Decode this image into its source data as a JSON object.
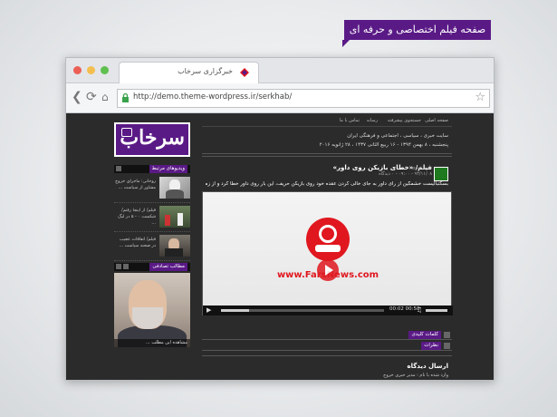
{
  "promo": {
    "label": "صفحه فیلم اختصاصی و حرفه ای",
    "color": "#5a1a86"
  },
  "browser": {
    "tab_title": "خبرگزاری سرخاب",
    "url": "http://demo.theme-wordpress.ir/serkhab/"
  },
  "site": {
    "logo": "سرخاب",
    "menu": [
      "صفحه اصلی",
      "جستجوی پیشرفته",
      "رسانه",
      "تماس با ما"
    ],
    "tagline": "سایت خبری ، سیاسی ، اجتماعی و فرهنگی ایران",
    "date": "پنجشنبه ، ۸ بهمن ۱۳۹۴ - ۱۶ ربیع الثانی ۱۴۳۷ ، ۲۸ ژانویه ۲۰۱۶",
    "accent": "#5a1a86"
  },
  "sidebar": {
    "videos_label": "ویدیوهای مرتبط",
    "items": [
      {
        "text": "روحانی: ماجرای خروج مشاور از سیاست ..."
      },
      {
        "text": "فیلم/ از اینجا رفتم/ شکست ۰ - ۵ در لیگ ..."
      },
      {
        "text": "فیلم/ اتفاقات عجیب در صحنه سیاست ..."
      }
    ],
    "photo_label": "مطالب تصادفی",
    "photo_caption": "مشاهده این مطلب ..."
  },
  "post": {
    "title": "فیلم/ «خطای بازیکن روی داور»",
    "author": "مدیر خبری",
    "posted": "۹۴/۱۱/۰۸ - ۰۹:۰۰ - ۰ دیدگاه",
    "excerpt": "بسکتبالیست خشمگین از رای داور به جای خالی کردن عقده خود روی بازیکن حریف، این بار روی داور خطا کرد و از زمین اخراج شد."
  },
  "video": {
    "brand": "www.FarsNews.com",
    "time": "00:02",
    "duration": "00:58",
    "progress": 0.17
  },
  "sections": {
    "tags": "کلمات کلیدی",
    "comments": "نظرات"
  },
  "reply": {
    "title": "ارسال دیدگاه",
    "note": "وارد شده با نام : مدیر خبری خروج"
  }
}
